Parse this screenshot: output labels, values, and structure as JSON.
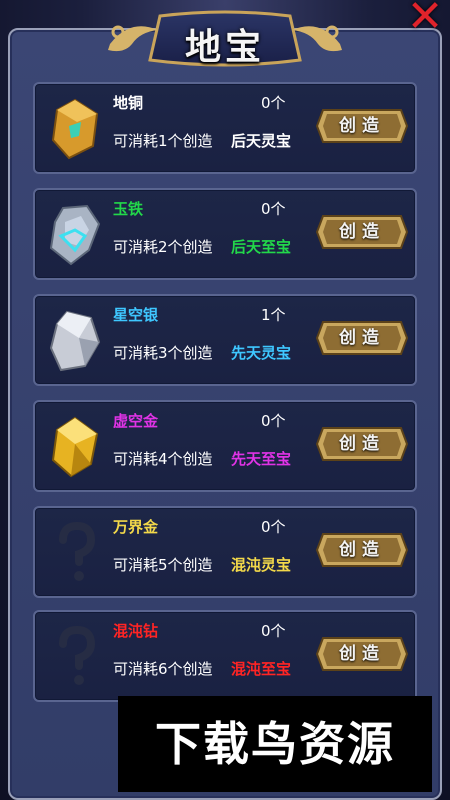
{
  "window": {
    "title": "地宝",
    "close_icon": "close-icon"
  },
  "items": [
    {
      "name": "地铜",
      "name_color": "#ffffff",
      "count": "0个",
      "cost": "可消耗1个创造",
      "grade": "后天灵宝",
      "grade_color": "#ffffff",
      "icon": "copper-ore-icon",
      "button": "创造"
    },
    {
      "name": "玉铁",
      "name_color": "#22d84a",
      "count": "0个",
      "cost": "可消耗2个创造",
      "grade": "后天至宝",
      "grade_color": "#22d84a",
      "icon": "jade-iron-icon",
      "button": "创造"
    },
    {
      "name": "星空银",
      "name_color": "#3ec7ff",
      "count": "1个",
      "cost": "可消耗3个创造",
      "grade": "先天灵宝",
      "grade_color": "#3ec7ff",
      "icon": "star-silver-icon",
      "button": "创造"
    },
    {
      "name": "虚空金",
      "name_color": "#e033e6",
      "count": "0个",
      "cost": "可消耗4个创造",
      "grade": "先天至宝",
      "grade_color": "#e033e6",
      "icon": "void-gold-icon",
      "button": "创造"
    },
    {
      "name": "万界金",
      "name_color": "#f2d84a",
      "count": "0个",
      "cost": "可消耗5个创造",
      "grade": "混沌灵宝",
      "grade_color": "#f2d84a",
      "icon": "unknown-icon",
      "button": "创造"
    },
    {
      "name": "混沌钻",
      "name_color": "#ff2424",
      "count": "0个",
      "cost": "可消耗6个创造",
      "grade": "混沌至宝",
      "grade_color": "#ff2424",
      "icon": "unknown-icon",
      "button": "创造"
    }
  ],
  "watermark": "下载鸟资源"
}
